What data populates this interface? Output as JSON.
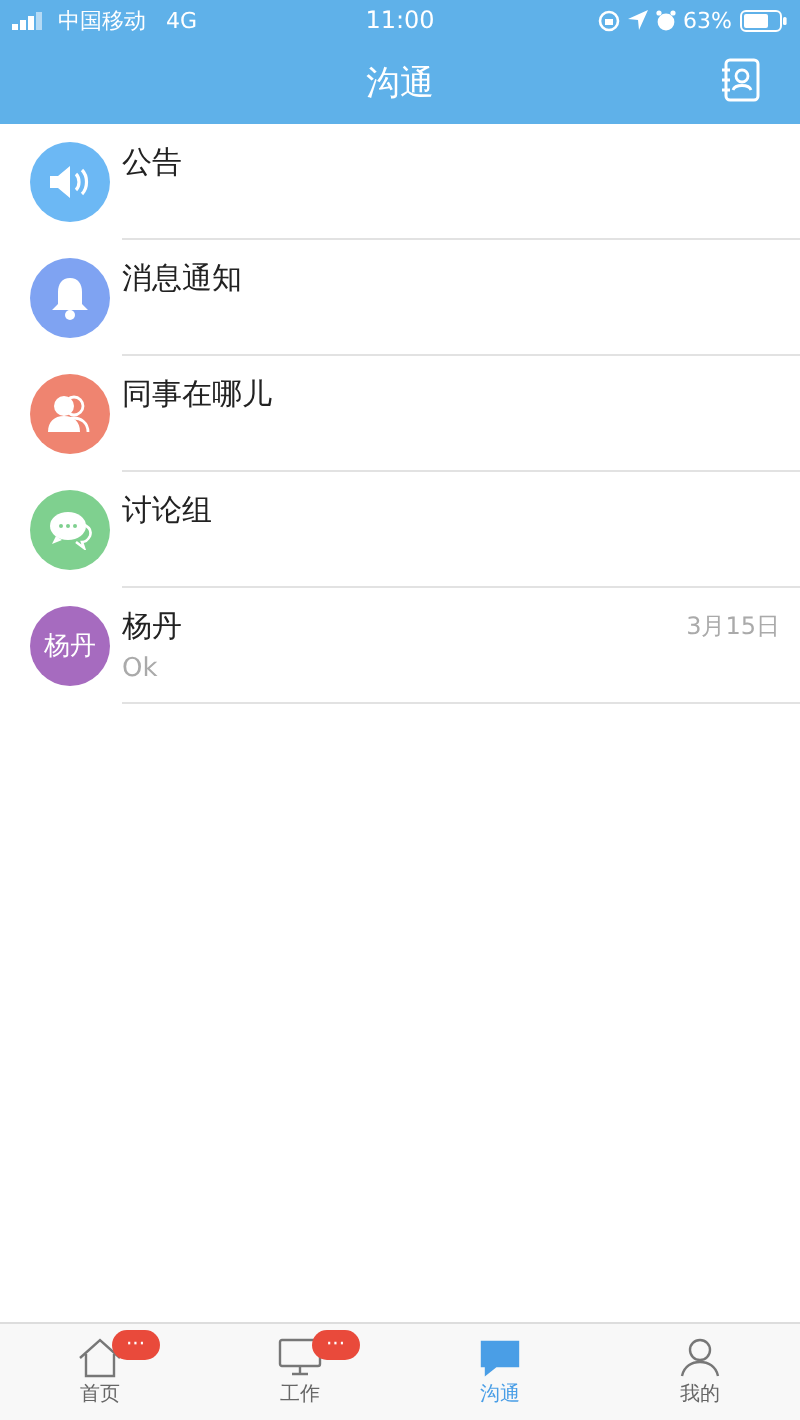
{
  "status_bar": {
    "carrier": "中国移动",
    "network": "4G",
    "time": "11:00",
    "battery": "63%"
  },
  "header": {
    "title": "沟通"
  },
  "conversations": [
    {
      "kind": "announcement",
      "title": "公告",
      "color": "#6cb8f4"
    },
    {
      "kind": "notification",
      "title": "消息通知",
      "color": "#7fa3f2"
    },
    {
      "kind": "colleagues",
      "title": "同事在哪儿",
      "color": "#ef8470"
    },
    {
      "kind": "discussion",
      "title": "讨论组",
      "color": "#7fd08f"
    },
    {
      "kind": "contact",
      "title": "杨丹",
      "avatar": "杨丹",
      "date": "3月15日",
      "preview": "Ok",
      "color": "#a66bbf"
    }
  ],
  "tabs": [
    {
      "kind": "home",
      "label": "首页",
      "selected": false,
      "badge": "···"
    },
    {
      "kind": "work",
      "label": "工作",
      "selected": false,
      "badge": "···"
    },
    {
      "kind": "chat",
      "label": "沟通",
      "selected": true
    },
    {
      "kind": "profile",
      "label": "我的",
      "selected": false
    }
  ]
}
